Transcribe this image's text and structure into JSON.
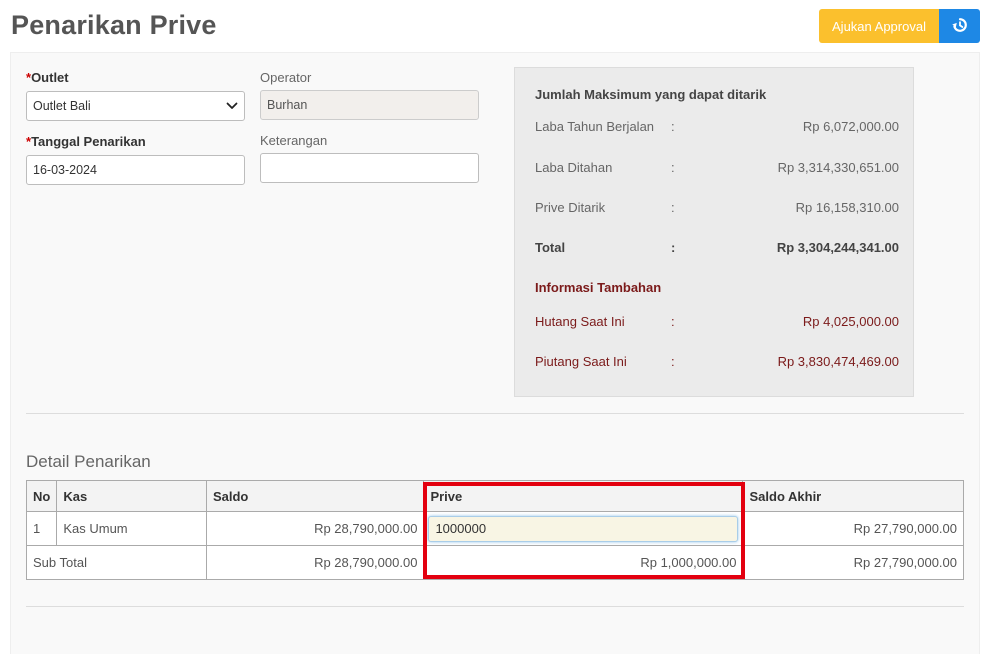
{
  "page": {
    "title": "Penarikan Prive",
    "approval_button": "Ajukan Approval",
    "history_icon": "history-icon",
    "accent_yellow": "#fbc02d",
    "accent_blue": "#1e88e5",
    "highlight_color": "#e3000f"
  },
  "form": {
    "outlet_label": "Outlet",
    "outlet_value": "Outlet Bali",
    "operator_label": "Operator",
    "operator_value": "Burhan",
    "tanggal_label": "Tanggal Penarikan",
    "tanggal_value": "16-03-2024",
    "keterangan_label": "Keterangan",
    "keterangan_value": "",
    "required_mark": "*"
  },
  "summary": {
    "heading": "Jumlah Maksimum yang dapat ditarik",
    "separator": ":",
    "rows": [
      {
        "label": "Laba Tahun Berjalan",
        "value": "Rp 6,072,000.00"
      },
      {
        "label": "Laba Ditahan",
        "value": "Rp 3,314,330,651.00"
      },
      {
        "label": "Prive Ditarik",
        "value": "Rp 16,158,310.00"
      },
      {
        "label": "Total",
        "value": "Rp 3,304,244,341.00"
      }
    ],
    "extra_heading": "Informasi Tambahan",
    "extra_rows": [
      {
        "label": "Hutang Saat Ini",
        "value": "Rp 4,025,000.00"
      },
      {
        "label": "Piutang Saat Ini",
        "value": "Rp 3,830,474,469.00"
      }
    ]
  },
  "detail": {
    "title": "Detail Penarikan",
    "headers": [
      "No",
      "Kas",
      "Saldo",
      "Prive",
      "Saldo Akhir"
    ],
    "rows": [
      {
        "no": "1",
        "kas": "Kas Umum",
        "saldo": "Rp 28,790,000.00",
        "prive": "1000000",
        "saldo_akhir": "Rp 27,790,000.00"
      }
    ],
    "subtotal": {
      "label": "Sub Total",
      "saldo": "Rp 28,790,000.00",
      "prive": "Rp 1,000,000.00",
      "saldo_akhir": "Rp 27,790,000.00"
    }
  }
}
